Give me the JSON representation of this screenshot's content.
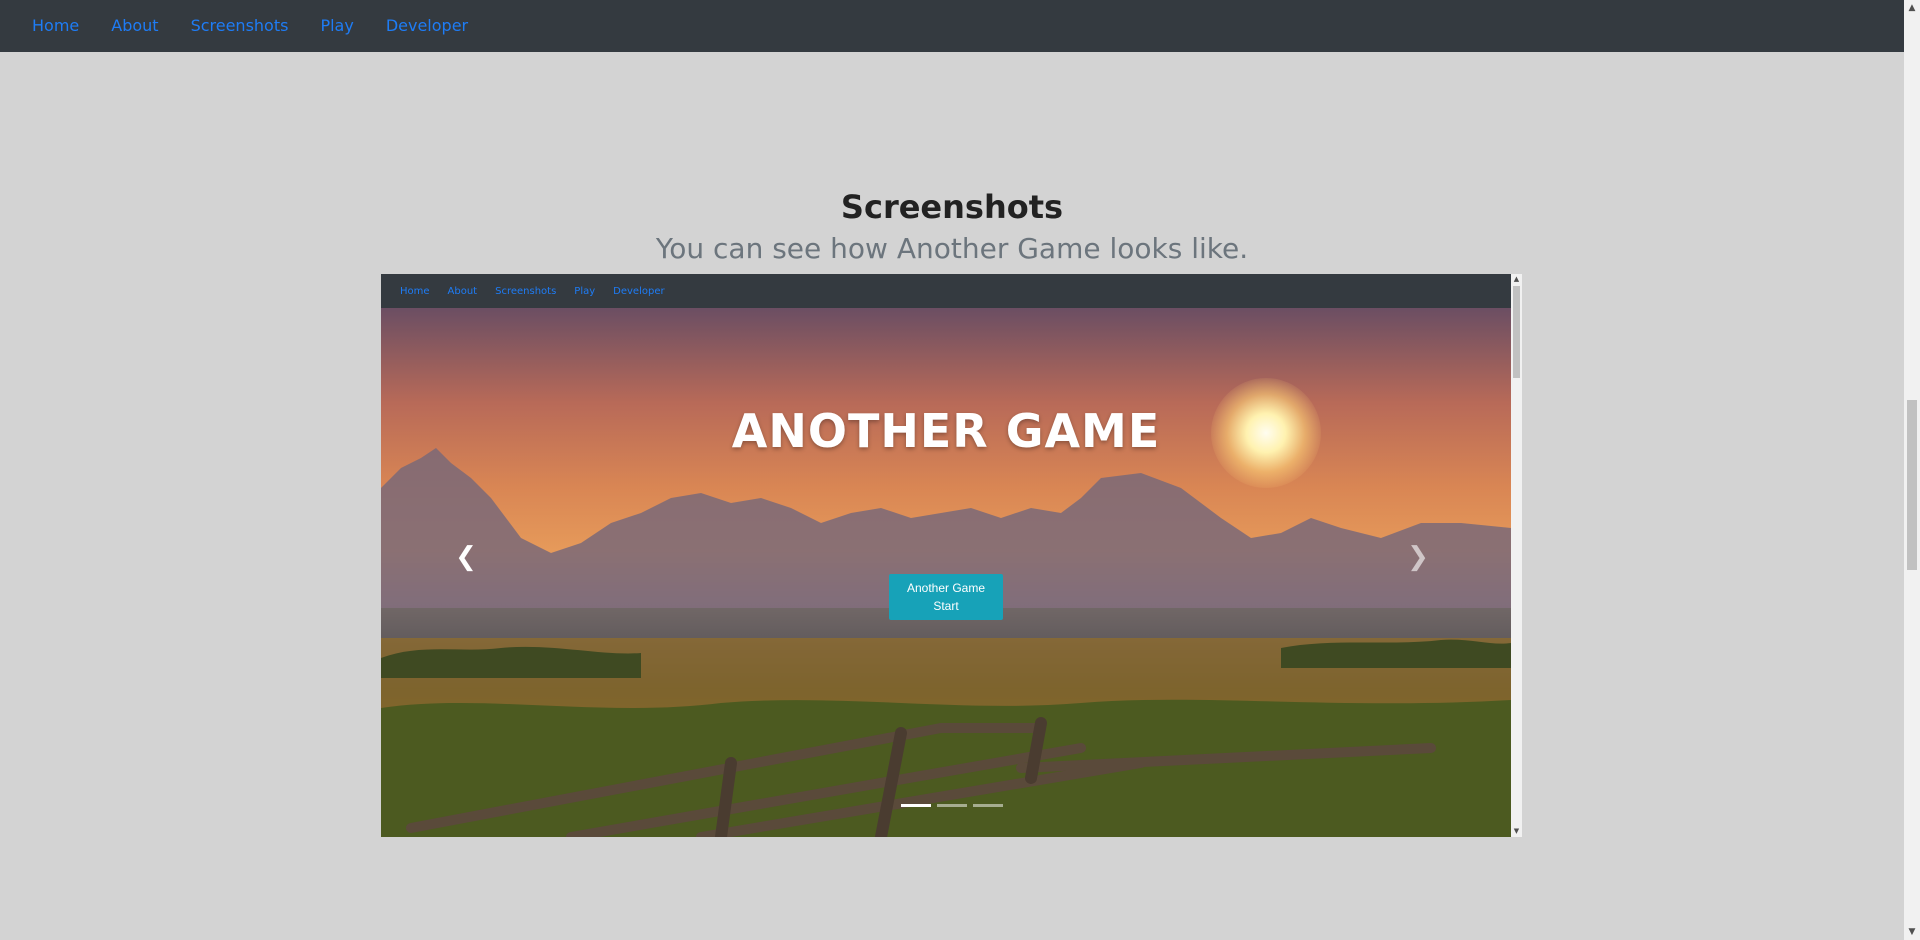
{
  "nav": {
    "items": [
      {
        "label": "Home"
      },
      {
        "label": "About"
      },
      {
        "label": "Screenshots"
      },
      {
        "label": "Play"
      },
      {
        "label": "Developer"
      }
    ]
  },
  "section": {
    "title": "Screenshots",
    "subtitle": "You can see how Another Game looks like."
  },
  "embedded": {
    "nav_items": [
      {
        "label": "Home"
      },
      {
        "label": "About"
      },
      {
        "label": "Screenshots"
      },
      {
        "label": "Play"
      },
      {
        "label": "Developer"
      }
    ],
    "hero_title": "ANOTHER GAME",
    "start_button": {
      "line1": "Another Game",
      "line2": "Start"
    },
    "carousel": {
      "slide_count": 3,
      "active_slide": 1
    }
  },
  "colors": {
    "nav_bg": "#343a40",
    "link": "#1e7cf5",
    "page_bg": "#d3d3d3",
    "button": "#17a2b8"
  },
  "icons": {
    "prev": "chevron-left-icon",
    "next": "chevron-right-icon"
  }
}
